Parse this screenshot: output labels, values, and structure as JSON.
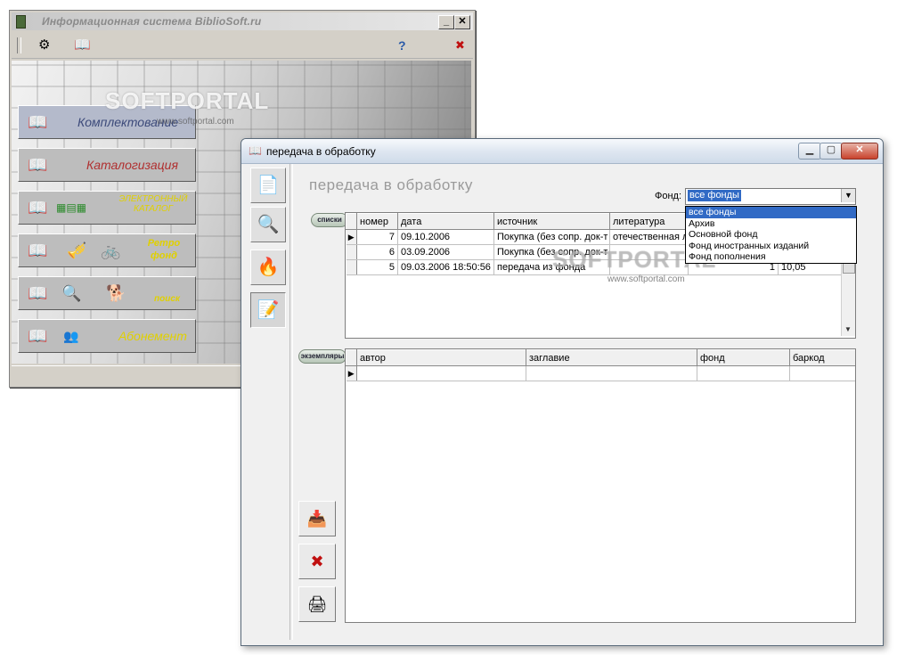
{
  "main_window": {
    "title": "Информационная система BiblioSoft.ru",
    "controls": {
      "minimize": "_",
      "close": "✕"
    },
    "toolbar": {
      "help": "?",
      "close": "✖"
    },
    "menu": [
      {
        "label": "Комплектование",
        "color": "#3c4a7a"
      },
      {
        "label": "Каталогизация",
        "color": "#b03030"
      },
      {
        "label": "ЭЛЕКТРОННЫЙ КАТАЛОГ",
        "color": "#e0d000"
      },
      {
        "label": "Ретро фонд",
        "color": "#e0d000"
      },
      {
        "label": "поиск",
        "color": "#e0d000"
      },
      {
        "label": "Абонемент",
        "color": "#e0d000"
      }
    ]
  },
  "watermark": {
    "text": "SOFTPORTAL",
    "url": "www.softportal.com"
  },
  "doc_window": {
    "title": "передача в обработку",
    "form_title": "передача в обработку",
    "fund": {
      "label": "Фонд:",
      "selected": "все фонды",
      "options": [
        "все фонды",
        "Архив",
        "Основной фонд",
        "Фонд иностранных изданий",
        "Фонд пополнения"
      ]
    },
    "lists": {
      "tag": "списки",
      "columns": [
        "номер",
        "дата",
        "источник",
        "литература"
      ],
      "rows": [
        {
          "num": "7",
          "date": "09.10.2006",
          "source": "Покупка (без сопр. док-т",
          "lit": "отечественная л",
          "extra1": "",
          "extra2": ""
        },
        {
          "num": "6",
          "date": "03.09.2006",
          "source": "Покупка (без сопр. док-т",
          "lit": "",
          "extra1": "",
          "extra2": ""
        },
        {
          "num": "5",
          "date": "09.03.2006 18:50:56",
          "source": "передача из фонда",
          "lit": "",
          "extra1": "1",
          "extra2": "10,05"
        }
      ]
    },
    "copies": {
      "tag": "экземпляры",
      "columns": [
        "автор",
        "заглавие",
        "фонд",
        "баркод"
      ]
    }
  }
}
